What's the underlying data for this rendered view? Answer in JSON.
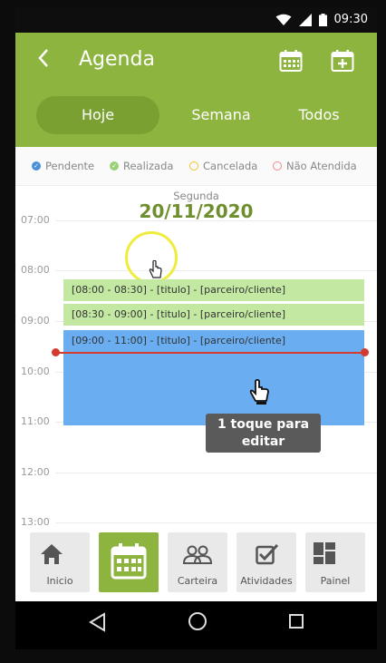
{
  "status_bar": {
    "time": "09:30"
  },
  "header": {
    "back_icon": "chevron-left-icon",
    "title": "Agenda",
    "actions": [
      "calendar-icon",
      "calendar-add-icon"
    ]
  },
  "tabs": [
    {
      "label": "Hoje",
      "active": true
    },
    {
      "label": "Semana",
      "active": false
    },
    {
      "label": "Todos",
      "active": false
    }
  ],
  "legend": [
    {
      "label": "Pendente",
      "color": "#4a90d9",
      "filled": true
    },
    {
      "label": "Realizada",
      "color": "#9ad177",
      "filled": true
    },
    {
      "label": "Cancelada",
      "color": "#f0c230",
      "filled": false
    },
    {
      "label": "Não Atendida",
      "color": "#f28a8a",
      "filled": false
    }
  ],
  "calendar": {
    "day_name": "Segunda",
    "date": "20/11/2020",
    "hours": [
      "07:00",
      "08:00",
      "09:00",
      "10:00",
      "11:00",
      "12:00",
      "13:00"
    ],
    "events": [
      {
        "text": "[08:00 - 08:30]  -  [titulo]  -  [parceiro/cliente]",
        "status": "Realizada"
      },
      {
        "text": "[08:30 - 09:00]  -  [titulo]  -  [parceiro/cliente]",
        "status": "Realizada"
      },
      {
        "text": "[09:00 - 11:00]  -  [titulo]  -  [parceiro/cliente]",
        "status": "Pendente"
      }
    ],
    "tooltip": [
      "1 toque para",
      "editar"
    ]
  },
  "bottom_nav": [
    {
      "label": "Inicio",
      "icon": "home-icon",
      "active": false
    },
    {
      "label": "",
      "icon": "calendar-icon",
      "active": true
    },
    {
      "label": "Carteira",
      "icon": "people-icon",
      "active": false
    },
    {
      "label": "Atividades",
      "icon": "checkbox-icon",
      "active": false
    },
    {
      "label": "Painel",
      "icon": "dashboard-icon",
      "active": false
    }
  ],
  "colors": {
    "brand_green": "#8db43f",
    "dark_green": "#6f8f2e",
    "event_green": "#c2e8a2",
    "event_blue": "#6aaef1",
    "now_line": "#d33b2f"
  }
}
